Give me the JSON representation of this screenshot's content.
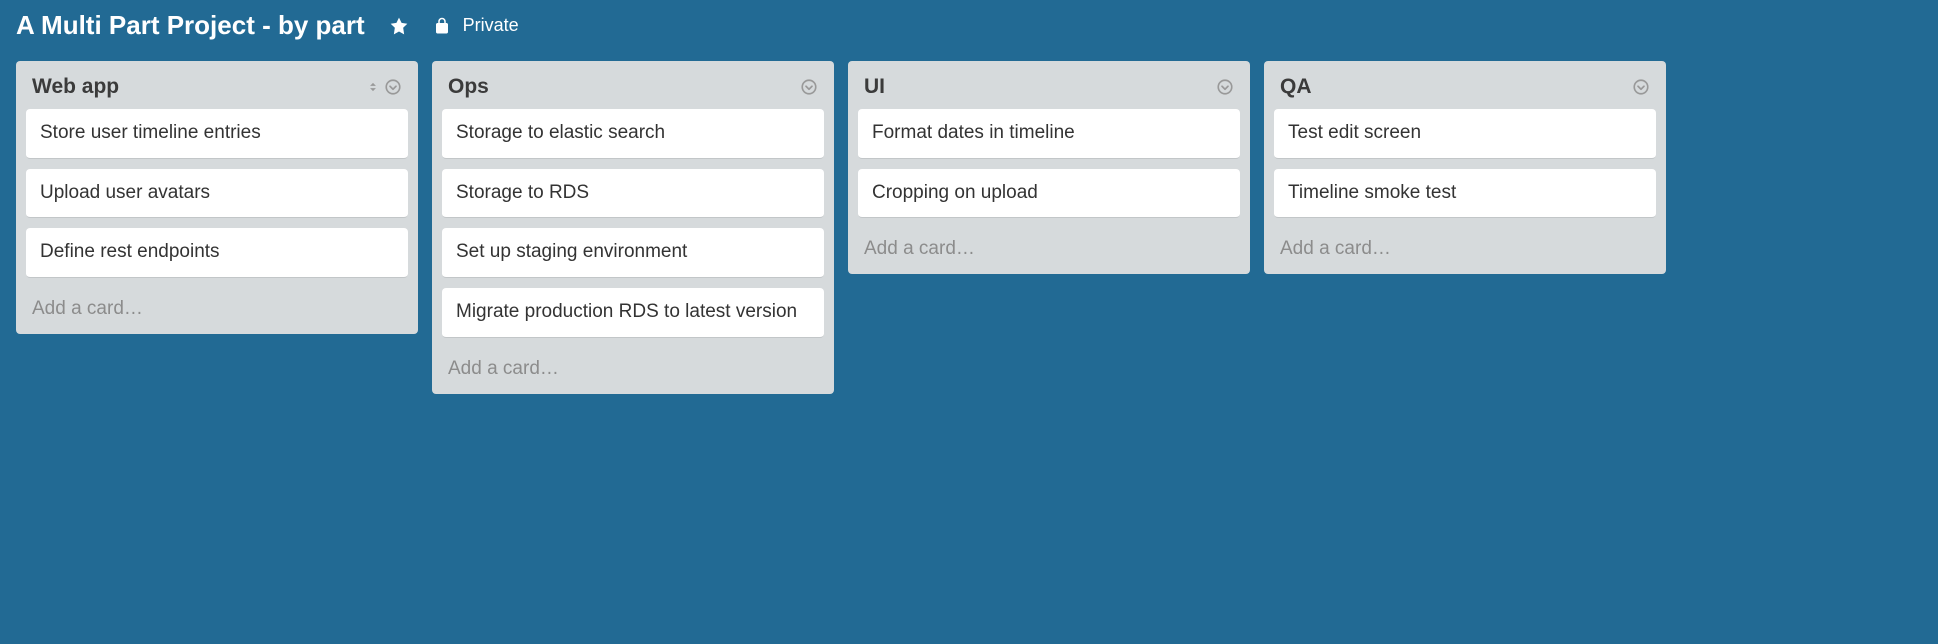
{
  "board": {
    "title": "A Multi Part Project - by part",
    "privacy_label": "Private",
    "add_card_label": "Add a card…"
  },
  "lists": [
    {
      "title": "Web app",
      "show_sort": true,
      "cards": [
        "Store user timeline entries",
        "Upload user avatars",
        "Define rest endpoints"
      ]
    },
    {
      "title": "Ops",
      "show_sort": false,
      "cards": [
        "Storage to elastic search",
        "Storage to RDS",
        "Set up staging environment",
        "Migrate production RDS to latest version"
      ]
    },
    {
      "title": "UI",
      "show_sort": false,
      "cards": [
        "Format dates in timeline",
        "Cropping on upload"
      ]
    },
    {
      "title": "QA",
      "show_sort": false,
      "cards": [
        "Test edit screen",
        "Timeline smoke test"
      ]
    }
  ]
}
